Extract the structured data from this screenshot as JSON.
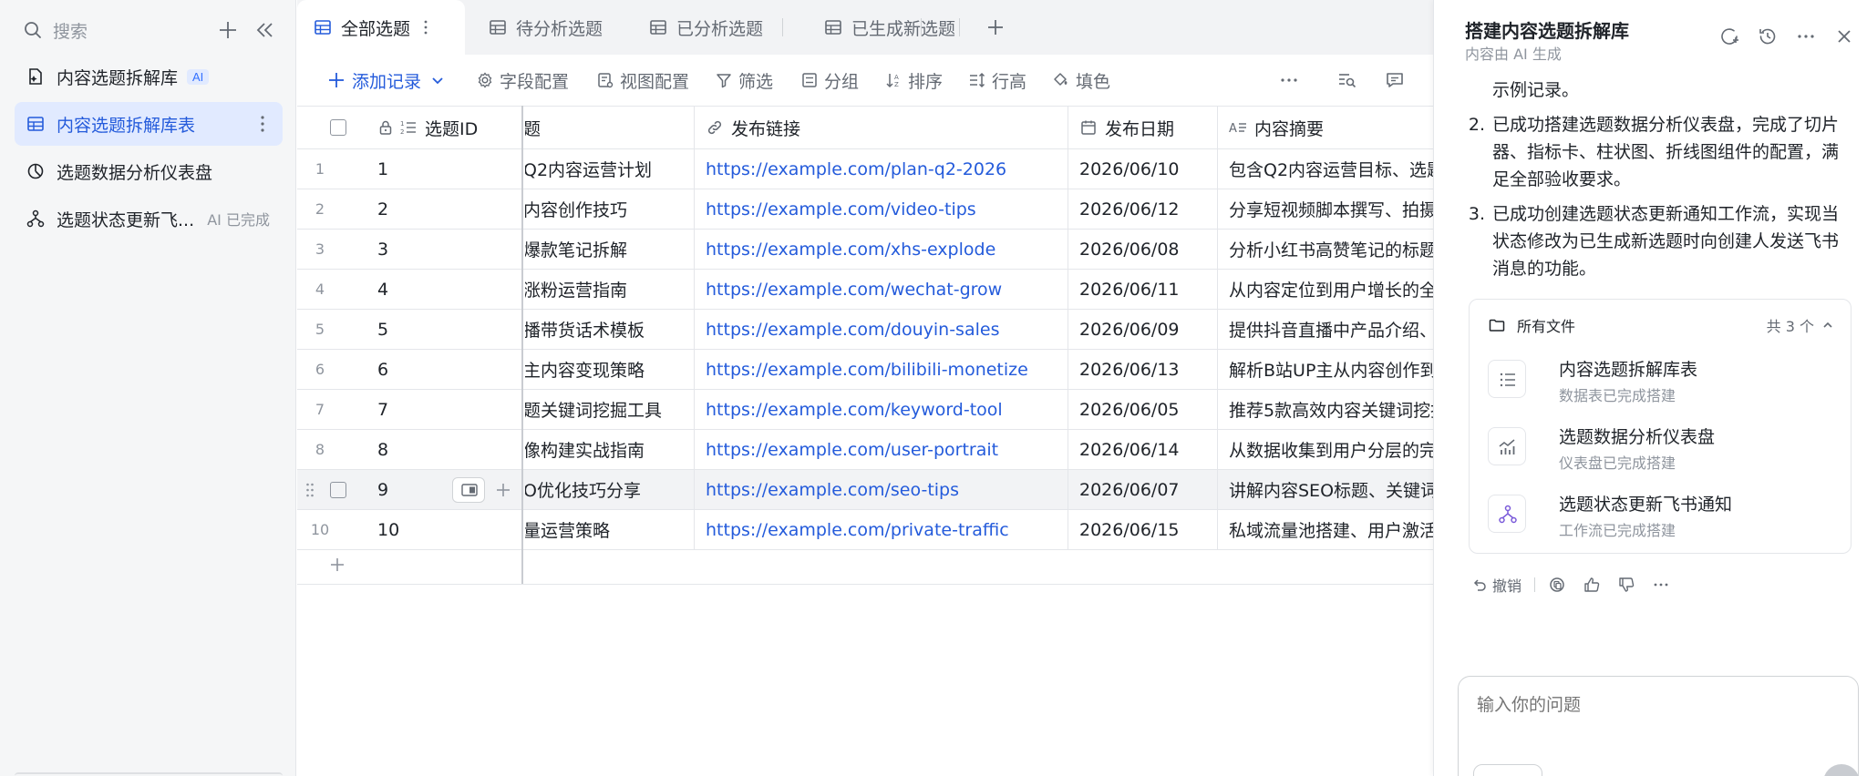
{
  "sidebar": {
    "search_placeholder": "搜索",
    "items": [
      {
        "label": "内容选题拆解库",
        "badge": "AI"
      },
      {
        "label": "内容选题拆解库表"
      },
      {
        "label": "选题数据分析仪表盘"
      },
      {
        "label": "选题状态更新飞...",
        "status": "AI 已完成"
      }
    ]
  },
  "tabs": [
    {
      "label": "全部选题"
    },
    {
      "label": "待分析选题"
    },
    {
      "label": "已分析选题"
    },
    {
      "label": "已生成新选题"
    }
  ],
  "toolbar": {
    "add_record": "添加记录",
    "field_config": "字段配置",
    "view_config": "视图配置",
    "filter": "筛选",
    "group": "分组",
    "sort": "排序",
    "row_height": "行高",
    "fill_color": "填色"
  },
  "table": {
    "headers": {
      "id": "选题ID",
      "title": "题",
      "link": "发布链接",
      "date": "发布日期",
      "summary": "内容摘要"
    },
    "rows": [
      {
        "idx": "1",
        "id": "1",
        "title": "Q2内容运营计划",
        "link": "https://example.com/plan-q2-2026",
        "date": "2026/06/10",
        "summary": "包含Q2内容运营目标、选题"
      },
      {
        "idx": "2",
        "id": "2",
        "title": "内容创作技巧",
        "link": "https://example.com/video-tips",
        "date": "2026/06/12",
        "summary": "分享短视频脚本撰写、拍摄"
      },
      {
        "idx": "3",
        "id": "3",
        "title": "爆款笔记拆解",
        "link": "https://example.com/xhs-explode",
        "date": "2026/06/08",
        "summary": "分析小红书高赞笔记的标题"
      },
      {
        "idx": "4",
        "id": "4",
        "title": "涨粉运营指南",
        "link": "https://example.com/wechat-grow",
        "date": "2026/06/11",
        "summary": "从内容定位到用户增长的全"
      },
      {
        "idx": "5",
        "id": "5",
        "title": "播带货话术模板",
        "link": "https://example.com/douyin-sales",
        "date": "2026/06/09",
        "summary": "提供抖音直播中产品介绍、"
      },
      {
        "idx": "6",
        "id": "6",
        "title": "主内容变现策略",
        "link": "https://example.com/bilibili-monetize",
        "date": "2026/06/13",
        "summary": "解析B站UP主从内容创作到"
      },
      {
        "idx": "7",
        "id": "7",
        "title": "题关键词挖掘工具",
        "link": "https://example.com/keyword-tool",
        "date": "2026/06/05",
        "summary": "推荐5款高效内容关键词挖掘"
      },
      {
        "idx": "8",
        "id": "8",
        "title": "像构建实战指南",
        "link": "https://example.com/user-portrait",
        "date": "2026/06/14",
        "summary": "从数据收集到用户分层的完"
      },
      {
        "idx": "",
        "id": "9",
        "title": "O优化技巧分享",
        "link": "https://example.com/seo-tips",
        "date": "2026/06/07",
        "summary": "讲解内容SEO标题、关键词"
      },
      {
        "idx": "10",
        "id": "10",
        "title": "量运营策略",
        "link": "https://example.com/private-traffic",
        "date": "2026/06/15",
        "summary": "私域流量池搭建、用户激活"
      }
    ]
  },
  "panel": {
    "title": "搭建内容选题拆解库",
    "subtitle": "内容由 AI 生成",
    "intro_tail": "示例记录。",
    "list": [
      {
        "num": "2.",
        "text": "已成功搭建选题数据分析仪表盘，完成了切片器、指标卡、柱状图、折线图组件的配置，满足全部验收要求。"
      },
      {
        "num": "3.",
        "text": "已成功创建选题状态更新通知工作流，实现当状态修改为已生成新选题时向创建人发送飞书消息的功能。"
      }
    ],
    "files": {
      "title": "所有文件",
      "count": "共 3 个",
      "items": [
        {
          "name": "内容选题拆解库表",
          "status": "数据表已完成搭建"
        },
        {
          "name": "选题数据分析仪表盘",
          "status": "仪表盘已完成搭建"
        },
        {
          "name": "选题状态更新飞书通知",
          "status": "工作流已完成搭建"
        }
      ]
    },
    "undo": "撤销",
    "input_placeholder": "输入你的问题"
  }
}
